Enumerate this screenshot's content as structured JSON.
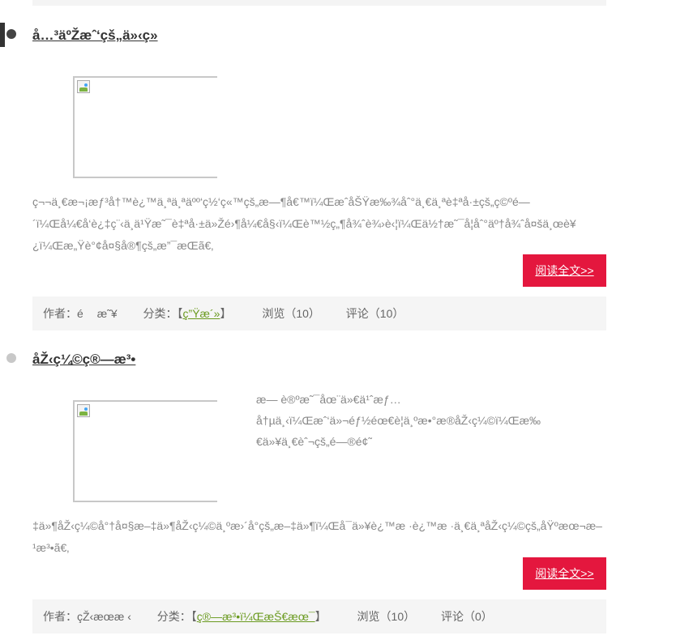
{
  "posts": [
    {
      "title": "å…³äºŽæˆ‘çš„ä»‹ç»",
      "excerpt": "ç¬¬ä¸€æ¬¡æƒ³å†™è¿™ä¸ªä¸ªäºº‘ç½‘ç«™çš„æ—¶å€™ï¼ŒæˆåŠŸæ‰¾åˆ°ä¸€ä¸ªè‡ªå·±çš„ç©ºé—´ï¼Œå¼€å‘è¿‡ç¨‹ä¸­ä¹Ÿæ˜¯è‡ªå·±ä»Žé›¶å¼€å§‹ï¼Œè™½ç„¶å¾ˆè¾›è‹¦ï¼Œä½†æ˜¯å­¦åˆ°äº†å¾ˆå¤šä¸œè¥¿ï¼Œæ„Ÿè°¢å¤§å®¶çš„æ”¯æŒã€‚",
      "read_more": "阅读全文>>",
      "author_label": "作者：",
      "author": "éæ˜¥",
      "category_label": "分类：",
      "category": "ç”Ÿæ´»",
      "views": "浏览（10）",
      "comments": "评论（10）"
    },
    {
      "title": "åŽ‹ç¼©ç®—æ³•",
      "side_excerpt": "æ— è®ºæ˜¯åœ¨ä»€ä¹ˆæƒ…å†µä¸‹ï¼Œæˆ‘ä»¬éƒ½éœ€è¦ä¸ºæ•°æ®åŽ‹ç¼©ï¼Œæ‰€ä»¥ä¸€èˆ¬çš„é—®é¢˜",
      "excerpt": "‡ä»¶åŽ‹ç¼©å°†å¤§æ–‡ä»¶åŽ‹ç¼©ä¸ºæ›´å°çš„æ–‡ä»¶ï¼Œå¯ä»¥è¿™æ ·è¿™æ ·ä¸€ä¸ªåŽ‹ç¼©çš„åŸºæœ¬æ–¹æ³•ã€‚",
      "read_more": "阅读全文>>",
      "author_label": "作者：",
      "author": "çŽ‹æœæ ‹",
      "category_label": "分类：",
      "category": "ç®—æ³•ï¼ŒæŠ€æœ¯",
      "views": "浏览（10）",
      "comments": "评论（0）"
    }
  ]
}
